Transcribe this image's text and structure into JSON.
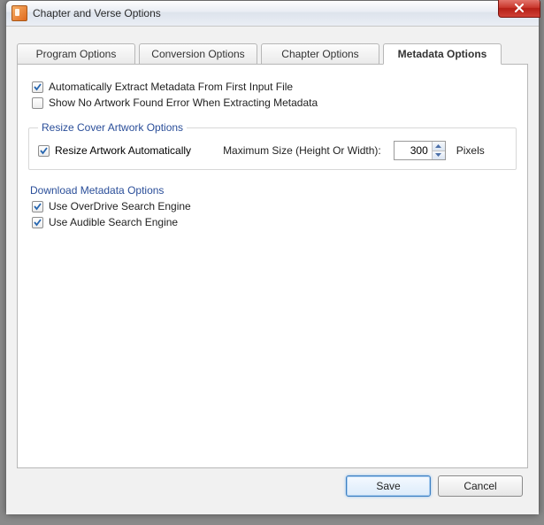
{
  "window": {
    "title": "Chapter and Verse Options"
  },
  "tabs": [
    {
      "label": "Program Options",
      "active": false
    },
    {
      "label": "Conversion Options",
      "active": false
    },
    {
      "label": "Chapter Options",
      "active": false
    },
    {
      "label": "Metadata Options",
      "active": true
    }
  ],
  "metadata": {
    "auto_extract": {
      "label": "Automatically Extract Metadata From First Input File",
      "checked": true
    },
    "show_no_artwork_error": {
      "label": "Show No Artwork Found Error When Extracting Metadata",
      "checked": false
    },
    "resize_group": {
      "legend": "Resize Cover Artwork Options",
      "resize_auto": {
        "label": "Resize Artwork Automatically",
        "checked": true
      },
      "max_size_label": "Maximum Size (Height Or Width):",
      "max_size_value": "300",
      "pixels_label": "Pixels"
    },
    "download_group": {
      "legend": "Download Metadata Options",
      "overdrive": {
        "label": "Use OverDrive Search Engine",
        "checked": true
      },
      "audible": {
        "label": "Use Audible Search Engine",
        "checked": true
      }
    }
  },
  "buttons": {
    "save": "Save",
    "cancel": "Cancel"
  }
}
